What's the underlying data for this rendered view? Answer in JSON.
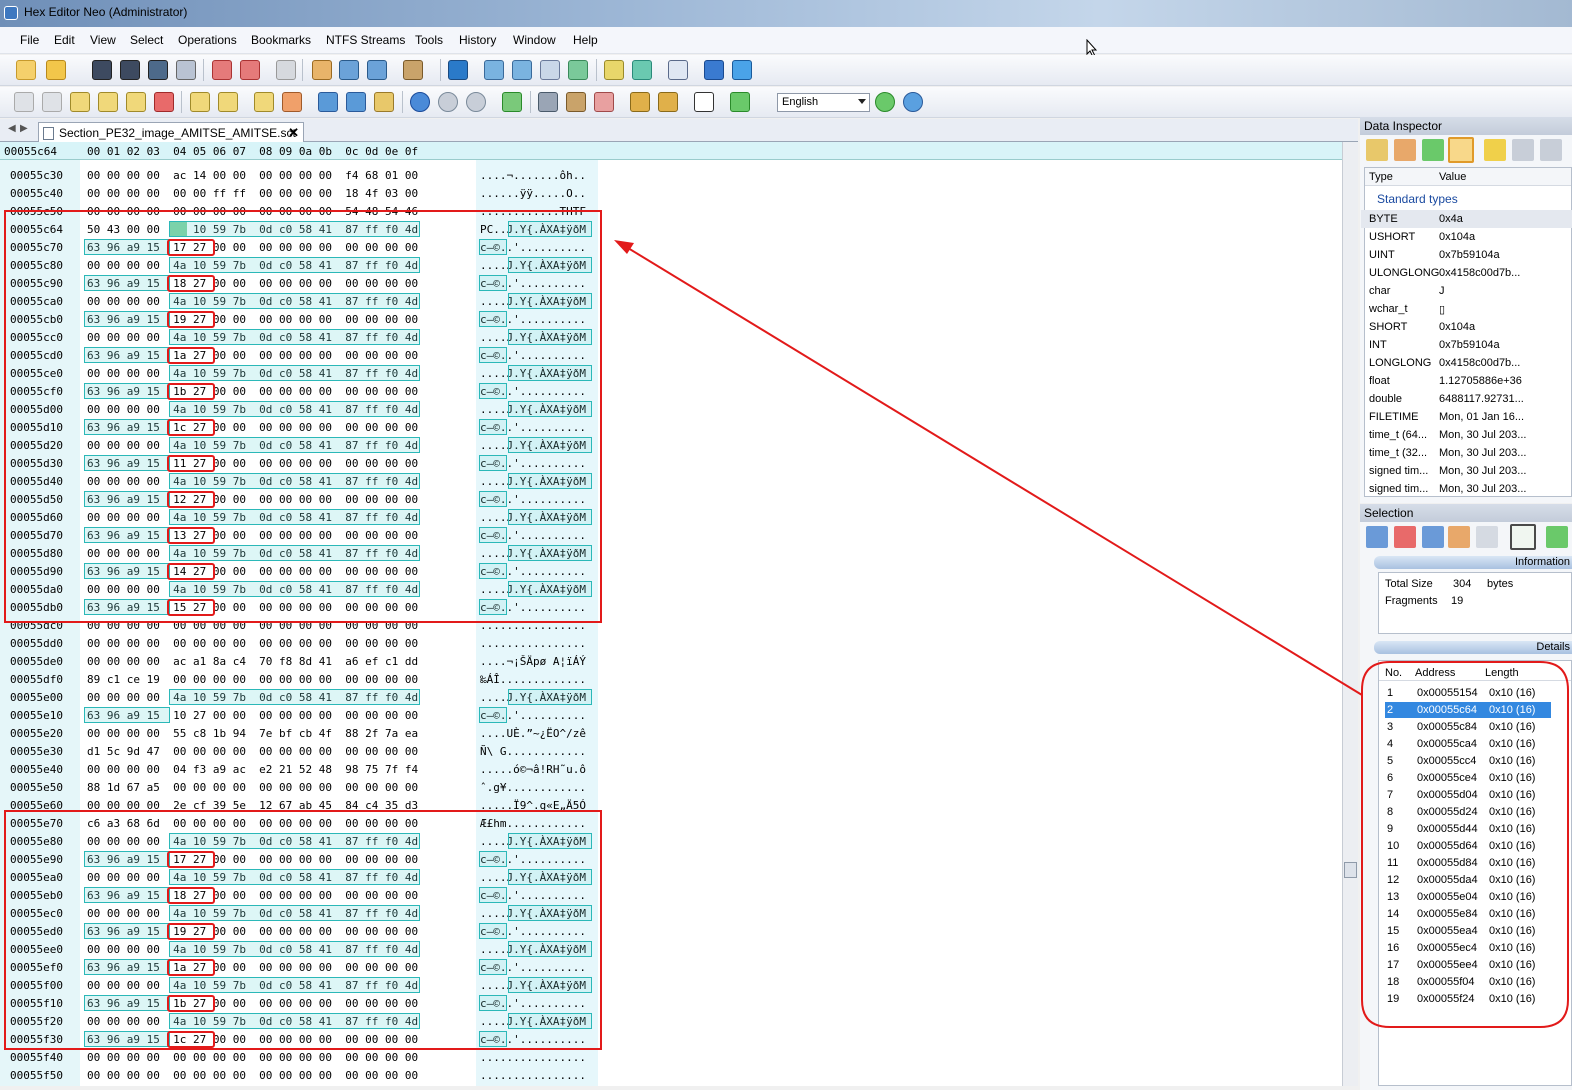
{
  "window": {
    "title": "Hex Editor Neo (Administrator)"
  },
  "menu": [
    "File",
    "Edit",
    "View",
    "Select",
    "Operations",
    "Bookmarks",
    "NTFS Streams",
    "Tools",
    "History",
    "Window",
    "Help"
  ],
  "toolbar": {
    "language": "English"
  },
  "tab": {
    "filename": "Section_PE32_image_AMITSE_AMITSE.sct"
  },
  "editor": {
    "current_offset": "00055c64",
    "column_header": "00 01 02 03  04 05 06 07  08 09 0a 0b  0c 0d 0e 0f",
    "rows": [
      {
        "a": "00055c30",
        "h": "00 00 00 00  ac 14 00 00  00 00 00 00  f4 68 01 00",
        "s": "....¬.......ôh.."
      },
      {
        "a": "00055c40",
        "h": "00 00 00 00  00 00 ff ff  00 00 00 00  18 4f 03 00",
        "s": "......ÿÿ.....O.."
      },
      {
        "a": "00055c50",
        "h": "00 00 00 00  00 00 00 00  00 00 00 00  54 48 54 46",
        "s": "............THTF"
      },
      {
        "a": "00055c64",
        "h": "50 43 00 00  4a 10 59 7b  0d c0 58 41  87 ff f0 4d",
        "s": "PC..J.Y{.ÀXA‡ÿðM"
      },
      {
        "a": "00055c70",
        "h": "63 96 a9 15  17 27 00 00  00 00 00 00  00 00 00 00",
        "s": "c–©..'.........."
      },
      {
        "a": "00055c80",
        "h": "00 00 00 00  4a 10 59 7b  0d c0 58 41  87 ff f0 4d",
        "s": "....J.Y{.ÀXA‡ÿðM"
      },
      {
        "a": "00055c90",
        "h": "63 96 a9 15  18 27 00 00  00 00 00 00  00 00 00 00",
        "s": "c–©..'.........."
      },
      {
        "a": "00055ca0",
        "h": "00 00 00 00  4a 10 59 7b  0d c0 58 41  87 ff f0 4d",
        "s": "....J.Y{.ÀXA‡ÿðM"
      },
      {
        "a": "00055cb0",
        "h": "63 96 a9 15  19 27 00 00  00 00 00 00  00 00 00 00",
        "s": "c–©..'.........."
      },
      {
        "a": "00055cc0",
        "h": "00 00 00 00  4a 10 59 7b  0d c0 58 41  87 ff f0 4d",
        "s": "....J.Y{.ÀXA‡ÿðM"
      },
      {
        "a": "00055cd0",
        "h": "63 96 a9 15  1a 27 00 00  00 00 00 00  00 00 00 00",
        "s": "c–©..'.........."
      },
      {
        "a": "00055ce0",
        "h": "00 00 00 00  4a 10 59 7b  0d c0 58 41  87 ff f0 4d",
        "s": "....J.Y{.ÀXA‡ÿðM"
      },
      {
        "a": "00055cf0",
        "h": "63 96 a9 15  1b 27 00 00  00 00 00 00  00 00 00 00",
        "s": "c–©..'.........."
      },
      {
        "a": "00055d00",
        "h": "00 00 00 00  4a 10 59 7b  0d c0 58 41  87 ff f0 4d",
        "s": "....J.Y{.ÀXA‡ÿðM"
      },
      {
        "a": "00055d10",
        "h": "63 96 a9 15  1c 27 00 00  00 00 00 00  00 00 00 00",
        "s": "c–©..'.........."
      },
      {
        "a": "00055d20",
        "h": "00 00 00 00  4a 10 59 7b  0d c0 58 41  87 ff f0 4d",
        "s": "....J.Y{.ÀXA‡ÿðM"
      },
      {
        "a": "00055d30",
        "h": "63 96 a9 15  11 27 00 00  00 00 00 00  00 00 00 00",
        "s": "c–©..'.........."
      },
      {
        "a": "00055d40",
        "h": "00 00 00 00  4a 10 59 7b  0d c0 58 41  87 ff f0 4d",
        "s": "....J.Y{.ÀXA‡ÿðM"
      },
      {
        "a": "00055d50",
        "h": "63 96 a9 15  12 27 00 00  00 00 00 00  00 00 00 00",
        "s": "c–©..'.........."
      },
      {
        "a": "00055d60",
        "h": "00 00 00 00  4a 10 59 7b  0d c0 58 41  87 ff f0 4d",
        "s": "....J.Y{.ÀXA‡ÿðM"
      },
      {
        "a": "00055d70",
        "h": "63 96 a9 15  13 27 00 00  00 00 00 00  00 00 00 00",
        "s": "c–©..'.........."
      },
      {
        "a": "00055d80",
        "h": "00 00 00 00  4a 10 59 7b  0d c0 58 41  87 ff f0 4d",
        "s": "....J.Y{.ÀXA‡ÿðM"
      },
      {
        "a": "00055d90",
        "h": "63 96 a9 15  14 27 00 00  00 00 00 00  00 00 00 00",
        "s": "c–©..'.........."
      },
      {
        "a": "00055da0",
        "h": "00 00 00 00  4a 10 59 7b  0d c0 58 41  87 ff f0 4d",
        "s": "....J.Y{.ÀXA‡ÿðM"
      },
      {
        "a": "00055db0",
        "h": "63 96 a9 15  15 27 00 00  00 00 00 00  00 00 00 00",
        "s": "c–©..'.........."
      },
      {
        "a": "00055dc0",
        "h": "00 00 00 00  00 00 00 00  00 00 00 00  00 00 00 00",
        "s": "................"
      },
      {
        "a": "00055dd0",
        "h": "00 00 00 00  00 00 00 00  00 00 00 00  00 00 00 00",
        "s": "................"
      },
      {
        "a": "00055de0",
        "h": "00 00 00 00  ac a1 8a c4  70 f8 8d 41  a6 ef c1 dd",
        "s": "....¬¡ŠÄpø A¦ïÁÝ"
      },
      {
        "a": "00055df0",
        "h": "89 c1 ce 19  00 00 00 00  00 00 00 00  00 00 00 00",
        "s": "‰ÁÎ............."
      },
      {
        "a": "00055e00",
        "h": "00 00 00 00  4a 10 59 7b  0d c0 58 41  87 ff f0 4d",
        "s": "....J.Y{.ÀXA‡ÿðM"
      },
      {
        "a": "00055e10",
        "h": "63 96 a9 15  10 27 00 00  00 00 00 00  00 00 00 00",
        "s": "c–©..'.........."
      },
      {
        "a": "00055e20",
        "h": "00 00 00 00  55 c8 1b 94  7e bf cb 4f  88 2f 7a ea",
        "s": "....UÈ.”~¿ËO^/zê"
      },
      {
        "a": "00055e30",
        "h": "d1 5c 9d 47  00 00 00 00  00 00 00 00  00 00 00 00",
        "s": "Ñ\\ G............"
      },
      {
        "a": "00055e40",
        "h": "00 00 00 00  04 f3 a9 ac  e2 21 52 48  98 75 7f f4",
        "s": ".....ó©¬â!RH˜u.ô"
      },
      {
        "a": "00055e50",
        "h": "88 1d 67 a5  00 00 00 00  00 00 00 00  00 00 00 00",
        "s": "ˆ.g¥............"
      },
      {
        "a": "00055e60",
        "h": "00 00 00 00  2e cf 39 5e  12 67 ab 45  84 c4 35 d3",
        "s": ".....Ï9^.g«E„Ä5Ó"
      },
      {
        "a": "00055e70",
        "h": "c6 a3 68 6d  00 00 00 00  00 00 00 00  00 00 00 00",
        "s": "Æ£hm............"
      },
      {
        "a": "00055e80",
        "h": "00 00 00 00  4a 10 59 7b  0d c0 58 41  87 ff f0 4d",
        "s": "....J.Y{.ÀXA‡ÿðM"
      },
      {
        "a": "00055e90",
        "h": "63 96 a9 15  17 27 00 00  00 00 00 00  00 00 00 00",
        "s": "c–©..'.........."
      },
      {
        "a": "00055ea0",
        "h": "00 00 00 00  4a 10 59 7b  0d c0 58 41  87 ff f0 4d",
        "s": "....J.Y{.ÀXA‡ÿðM"
      },
      {
        "a": "00055eb0",
        "h": "63 96 a9 15  18 27 00 00  00 00 00 00  00 00 00 00",
        "s": "c–©..'.........."
      },
      {
        "a": "00055ec0",
        "h": "00 00 00 00  4a 10 59 7b  0d c0 58 41  87 ff f0 4d",
        "s": "....J.Y{.ÀXA‡ÿðM"
      },
      {
        "a": "00055ed0",
        "h": "63 96 a9 15  19 27 00 00  00 00 00 00  00 00 00 00",
        "s": "c–©..'.........."
      },
      {
        "a": "00055ee0",
        "h": "00 00 00 00  4a 10 59 7b  0d c0 58 41  87 ff f0 4d",
        "s": "....J.Y{.ÀXA‡ÿðM"
      },
      {
        "a": "00055ef0",
        "h": "63 96 a9 15  1a 27 00 00  00 00 00 00  00 00 00 00",
        "s": "c–©..'.........."
      },
      {
        "a": "00055f00",
        "h": "00 00 00 00  4a 10 59 7b  0d c0 58 41  87 ff f0 4d",
        "s": "....J.Y{.ÀXA‡ÿðM"
      },
      {
        "a": "00055f10",
        "h": "63 96 a9 15  1b 27 00 00  00 00 00 00  00 00 00 00",
        "s": "c–©..'.........."
      },
      {
        "a": "00055f20",
        "h": "00 00 00 00  4a 10 59 7b  0d c0 58 41  87 ff f0 4d",
        "s": "....J.Y{.ÀXA‡ÿðM"
      },
      {
        "a": "00055f30",
        "h": "63 96 a9 15  1c 27 00 00  00 00 00 00  00 00 00 00",
        "s": "c–©..'.........."
      },
      {
        "a": "00055f40",
        "h": "00 00 00 00  00 00 00 00  00 00 00 00  00 00 00 00",
        "s": "................"
      },
      {
        "a": "00055f50",
        "h": "00 00 00 00  00 00 00 00  00 00 00 00  00 00 00 00",
        "s": "................"
      }
    ]
  },
  "inspector": {
    "title": "Data Inspector",
    "col_type": "Type",
    "col_value": "Value",
    "group": "Standard types",
    "rows": [
      {
        "k": "BYTE",
        "v": "0x4a"
      },
      {
        "k": "USHORT",
        "v": "0x104a"
      },
      {
        "k": "UINT",
        "v": "0x7b59104a"
      },
      {
        "k": "ULONGLONG",
        "v": "0x4158c00d7b..."
      },
      {
        "k": "char",
        "v": "J"
      },
      {
        "k": "wchar_t",
        "v": "▯"
      },
      {
        "k": "SHORT",
        "v": "0x104a"
      },
      {
        "k": "INT",
        "v": "0x7b59104a"
      },
      {
        "k": "LONGLONG",
        "v": "0x4158c00d7b..."
      },
      {
        "k": "float",
        "v": "1.12705886e+36"
      },
      {
        "k": "double",
        "v": "6488117.92731..."
      },
      {
        "k": "FILETIME",
        "v": "Mon, 01 Jan 16..."
      },
      {
        "k": "time_t (64...",
        "v": "Mon, 30 Jul 203..."
      },
      {
        "k": "time_t (32...",
        "v": "Mon, 30 Jul 203..."
      },
      {
        "k": "signed tim...",
        "v": "Mon, 30 Jul 203..."
      },
      {
        "k": "signed tim...",
        "v": "Mon, 30 Jul 203..."
      }
    ]
  },
  "selection": {
    "title": "Selection",
    "information": "Information",
    "total_size_label": "Total Size",
    "total_size": "304",
    "total_size_unit": "bytes",
    "fragments_label": "Fragments",
    "fragments": "19",
    "details": "Details",
    "col_no": "No.",
    "col_address": "Address",
    "col_length": "Length",
    "rows": [
      {
        "n": "1",
        "ad": "0x00055154",
        "ln": "0x10 (16)"
      },
      {
        "n": "2",
        "ad": "0x00055c64",
        "ln": "0x10 (16)"
      },
      {
        "n": "3",
        "ad": "0x00055c84",
        "ln": "0x10 (16)"
      },
      {
        "n": "4",
        "ad": "0x00055ca4",
        "ln": "0x10 (16)"
      },
      {
        "n": "5",
        "ad": "0x00055cc4",
        "ln": "0x10 (16)"
      },
      {
        "n": "6",
        "ad": "0x00055ce4",
        "ln": "0x10 (16)"
      },
      {
        "n": "7",
        "ad": "0x00055d04",
        "ln": "0x10 (16)"
      },
      {
        "n": "8",
        "ad": "0x00055d24",
        "ln": "0x10 (16)"
      },
      {
        "n": "9",
        "ad": "0x00055d44",
        "ln": "0x10 (16)"
      },
      {
        "n": "10",
        "ad": "0x00055d64",
        "ln": "0x10 (16)"
      },
      {
        "n": "11",
        "ad": "0x00055d84",
        "ln": "0x10 (16)"
      },
      {
        "n": "12",
        "ad": "0x00055da4",
        "ln": "0x10 (16)"
      },
      {
        "n": "13",
        "ad": "0x00055e04",
        "ln": "0x10 (16)"
      },
      {
        "n": "14",
        "ad": "0x00055e84",
        "ln": "0x10 (16)"
      },
      {
        "n": "15",
        "ad": "0x00055ea4",
        "ln": "0x10 (16)"
      },
      {
        "n": "16",
        "ad": "0x00055ec4",
        "ln": "0x10 (16)"
      },
      {
        "n": "17",
        "ad": "0x00055ee4",
        "ln": "0x10 (16)"
      },
      {
        "n": "18",
        "ad": "0x00055f04",
        "ln": "0x10 (16)"
      },
      {
        "n": "19",
        "ad": "0x00055f24",
        "ln": "0x10 (16)"
      }
    ]
  },
  "colors": {
    "annotation": "#e21a1a",
    "highlight": "#2bb8b8",
    "cursor": "#7ccf9a",
    "selected_row": "#3388e0"
  }
}
